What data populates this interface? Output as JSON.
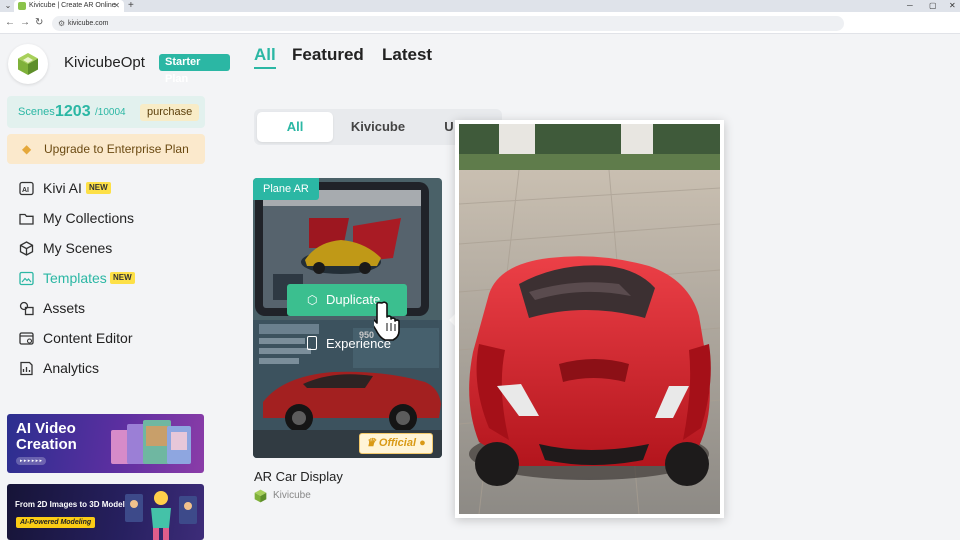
{
  "browser": {
    "tab_title": "Kivicube | Create AR Online",
    "url": "kivicube.com",
    "icons": [
      "chevron-down-icon",
      "favicon-icon",
      "close-icon",
      "plus-icon",
      "back-icon",
      "forward-icon",
      "reload-icon",
      "site-info-icon",
      "minimize-icon",
      "maximize-icon",
      "close-window-icon"
    ]
  },
  "sidebar": {
    "username": "KivicubeOpt",
    "plan": "Starter Plan",
    "scenes": {
      "label": "Scenes",
      "count": "1203",
      "max": "/10004",
      "purchase_label": "purchase"
    },
    "upgrade_label": "Upgrade to Enterprise Plan",
    "items": [
      {
        "label": "Kivi AI",
        "icon": "ai-icon",
        "badge": "NEW",
        "active": false
      },
      {
        "label": "My Collections",
        "icon": "folder-icon",
        "active": false
      },
      {
        "label": "My Scenes",
        "icon": "cube-icon",
        "active": false
      },
      {
        "label": "Templates",
        "icon": "template-icon",
        "badge": "NEW",
        "active": true
      },
      {
        "label": "Assets",
        "icon": "shapes-icon",
        "active": false
      },
      {
        "label": "Content Editor",
        "icon": "editor-icon",
        "active": false
      },
      {
        "label": "Analytics",
        "icon": "analytics-icon",
        "active": false
      }
    ],
    "banners": [
      {
        "title": "AI Video Creation"
      },
      {
        "title": "From 2D Images to 3D Models",
        "badge": "AI-Powered Modeling"
      }
    ]
  },
  "main": {
    "tabs": [
      {
        "label": "All",
        "active": true
      },
      {
        "label": "Featured",
        "active": false
      },
      {
        "label": "Latest",
        "active": false
      }
    ],
    "filters": [
      {
        "label": "All",
        "active": true
      },
      {
        "label": "Kivicube",
        "active": false
      },
      {
        "label": "U",
        "active": false
      }
    ],
    "card": {
      "type_label": "Plane AR",
      "duplicate_label": "Duplicate",
      "experience_label": "Experience",
      "official_label": "Official",
      "title": "AR Car Display",
      "author": "Kivicube"
    }
  },
  "colors": {
    "accent": "#2bb7a4",
    "badge_yellow": "#fde047",
    "car_red": "#d51e27"
  }
}
